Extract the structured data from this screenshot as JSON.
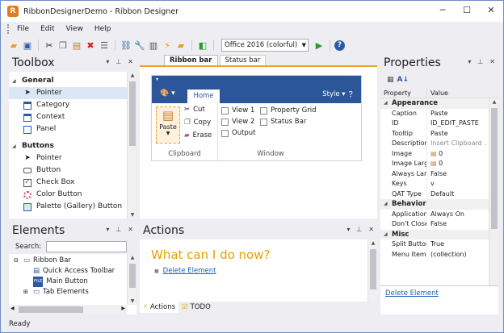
{
  "window": {
    "title": "RibbonDesignerDemo - Ribbon Designer",
    "minimize": "─",
    "maximize": "☐",
    "close": "✕"
  },
  "menu": {
    "items": [
      "File",
      "Edit",
      "View",
      "Help"
    ]
  },
  "toolbar": {
    "theme": "Office 2016 (colorful)"
  },
  "toolbox": {
    "title": "Toolbox",
    "groups": [
      {
        "name": "General",
        "items": [
          "Pointer",
          "Category",
          "Context",
          "Panel"
        ]
      },
      {
        "name": "Buttons",
        "items": [
          "Pointer",
          "Button",
          "Check Box",
          "Color Button",
          "Palette (Gallery) Button"
        ]
      }
    ]
  },
  "elements": {
    "title": "Elements",
    "search_label": "Search:",
    "tree": [
      "Ribbon Bar",
      "Quick Access Toolbar",
      "Main Button",
      "Tab Elements"
    ]
  },
  "document": {
    "tabs": [
      "Ribbon bar",
      "Status bar"
    ],
    "ribbon": {
      "home_tab": "Home",
      "style": "Style",
      "clipboard": {
        "paste": "Paste",
        "cut": "Cut",
        "copy": "Copy",
        "erase": "Erase",
        "label": "Clipboard"
      },
      "window": {
        "view1": "View 1",
        "view2": "View 2",
        "output": "Output",
        "property_grid": "Property Grid",
        "status_bar": "Status Bar",
        "label": "Window"
      }
    }
  },
  "actions": {
    "title": "Actions",
    "heading": "What can I do now?",
    "link": "Delete Element",
    "bottom_tabs": [
      "Actions",
      "TODO"
    ]
  },
  "properties": {
    "title": "Properties",
    "col_property": "Property",
    "col_value": "Value",
    "categories": [
      {
        "name": "Appearance",
        "rows": [
          [
            "Caption",
            "Paste"
          ],
          [
            "ID",
            "ID_EDIT_PASTE"
          ],
          [
            "Tooltip",
            "Paste"
          ],
          [
            "Description",
            "Insert Clipboard ..."
          ],
          [
            "Image",
            "0"
          ],
          [
            "Image Large",
            "0"
          ],
          [
            "Always Large",
            "False"
          ],
          [
            "Keys",
            "v"
          ],
          [
            "QAT Type",
            "Default"
          ]
        ]
      },
      {
        "name": "Behavior",
        "rows": [
          [
            "Application ...",
            "Always On"
          ],
          [
            "Don't Close ...",
            "False"
          ]
        ]
      },
      {
        "name": "Misc",
        "rows": [
          [
            "Split Button",
            "True"
          ],
          [
            "Menu Items",
            "(collection)"
          ]
        ]
      }
    ],
    "footer_link": "Delete Element"
  },
  "status": {
    "text": "Ready"
  }
}
